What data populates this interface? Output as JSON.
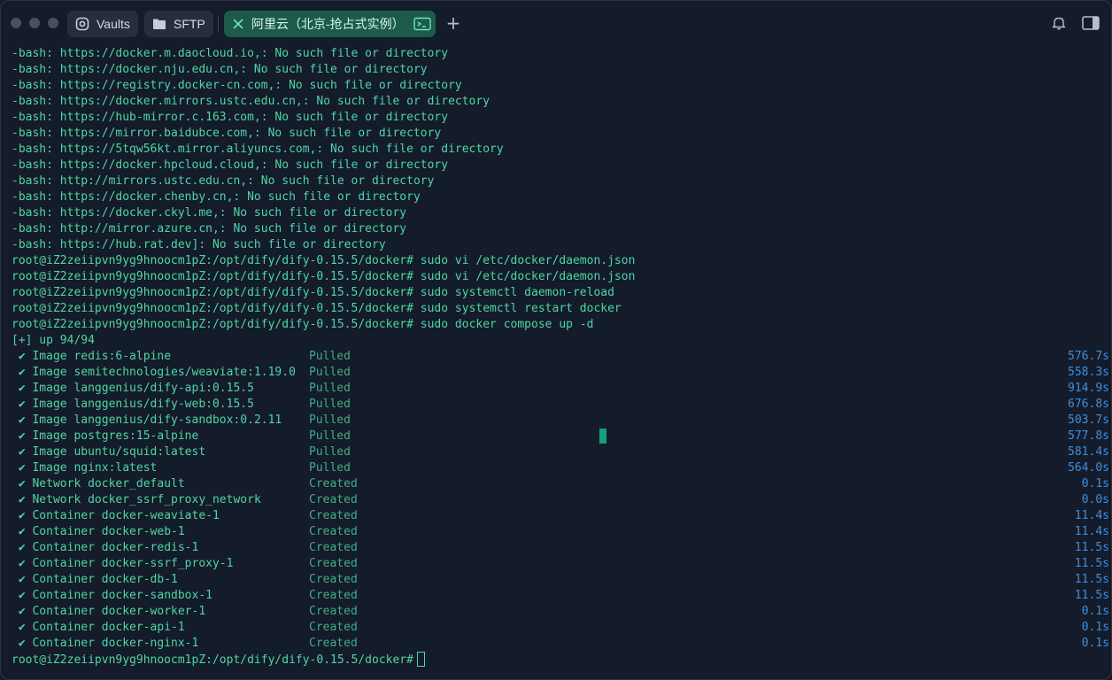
{
  "tabs": {
    "vaults": "Vaults",
    "sftp": "SFTP",
    "active": "阿里云（北京-抢占式实例）"
  },
  "bash_errors": [
    "-bash: https://docker.m.daocloud.io,: No such file or directory",
    "-bash: https://docker.nju.edu.cn,: No such file or directory",
    "-bash: https://registry.docker-cn.com,: No such file or directory",
    "-bash: https://docker.mirrors.ustc.edu.cn,: No such file or directory",
    "-bash: https://hub-mirror.c.163.com,: No such file or directory",
    "-bash: https://mirror.baidubce.com,: No such file or directory",
    "-bash: https://5tqw56kt.mirror.aliyuncs.com,: No such file or directory",
    "-bash: https://docker.hpcloud.cloud,: No such file or directory",
    "-bash: http://mirrors.ustc.edu.cn,: No such file or directory",
    "-bash: https://docker.chenby.cn,: No such file or directory",
    "-bash: https://docker.ckyl.me,: No such file or directory",
    "-bash: http://mirror.azure.cn,: No such file or directory",
    "-bash: https://hub.rat.dev]: No such file or directory"
  ],
  "prompt": "root@iZ2zeiipvn9yg9hnoocm1pZ:/opt/dify/dify-0.15.5/docker#",
  "commands": [
    "sudo vi /etc/docker/daemon.json",
    "sudo vi /etc/docker/daemon.json",
    "sudo systemctl daemon-reload",
    "sudo systemctl restart docker",
    "sudo docker compose up -d"
  ],
  "progress_header": "[+] up 94/94",
  "check_mark": "✔",
  "items": [
    {
      "label": "Image redis:6-alpine",
      "status": "Pulled",
      "time": "576.7s"
    },
    {
      "label": "Image semitechnologies/weaviate:1.19.0",
      "status": "Pulled",
      "time": "558.3s"
    },
    {
      "label": "Image langgenius/dify-api:0.15.5",
      "status": "Pulled",
      "time": "914.9s"
    },
    {
      "label": "Image langgenius/dify-web:0.15.5",
      "status": "Pulled",
      "time": "676.8s"
    },
    {
      "label": "Image langgenius/dify-sandbox:0.2.11",
      "status": "Pulled",
      "time": "503.7s"
    },
    {
      "label": "Image postgres:15-alpine",
      "status": "Pulled",
      "time": "577.8s"
    },
    {
      "label": "Image ubuntu/squid:latest",
      "status": "Pulled",
      "time": "581.4s"
    },
    {
      "label": "Image nginx:latest",
      "status": "Pulled",
      "time": "564.0s"
    },
    {
      "label": "Network docker_default",
      "status": "Created",
      "time": "0.1s"
    },
    {
      "label": "Network docker_ssrf_proxy_network",
      "status": "Created",
      "time": "0.0s"
    },
    {
      "label": "Container docker-weaviate-1",
      "status": "Created",
      "time": "11.4s"
    },
    {
      "label": "Container docker-web-1",
      "status": "Created",
      "time": "11.4s"
    },
    {
      "label": "Container docker-redis-1",
      "status": "Created",
      "time": "11.5s"
    },
    {
      "label": "Container docker-ssrf_proxy-1",
      "status": "Created",
      "time": "11.5s"
    },
    {
      "label": "Container docker-db-1",
      "status": "Created",
      "time": "11.5s"
    },
    {
      "label": "Container docker-sandbox-1",
      "status": "Created",
      "time": "11.5s"
    },
    {
      "label": "Container docker-worker-1",
      "status": "Created",
      "time": "0.1s"
    },
    {
      "label": "Container docker-api-1",
      "status": "Created",
      "time": "0.1s"
    },
    {
      "label": "Container docker-nginx-1",
      "status": "Created",
      "time": "0.1s"
    }
  ],
  "colors": {
    "background": "#141b2a",
    "accent_green": "#4fd6a6",
    "time_blue": "#3f8fe0",
    "active_tab": "#1d5a4c"
  }
}
